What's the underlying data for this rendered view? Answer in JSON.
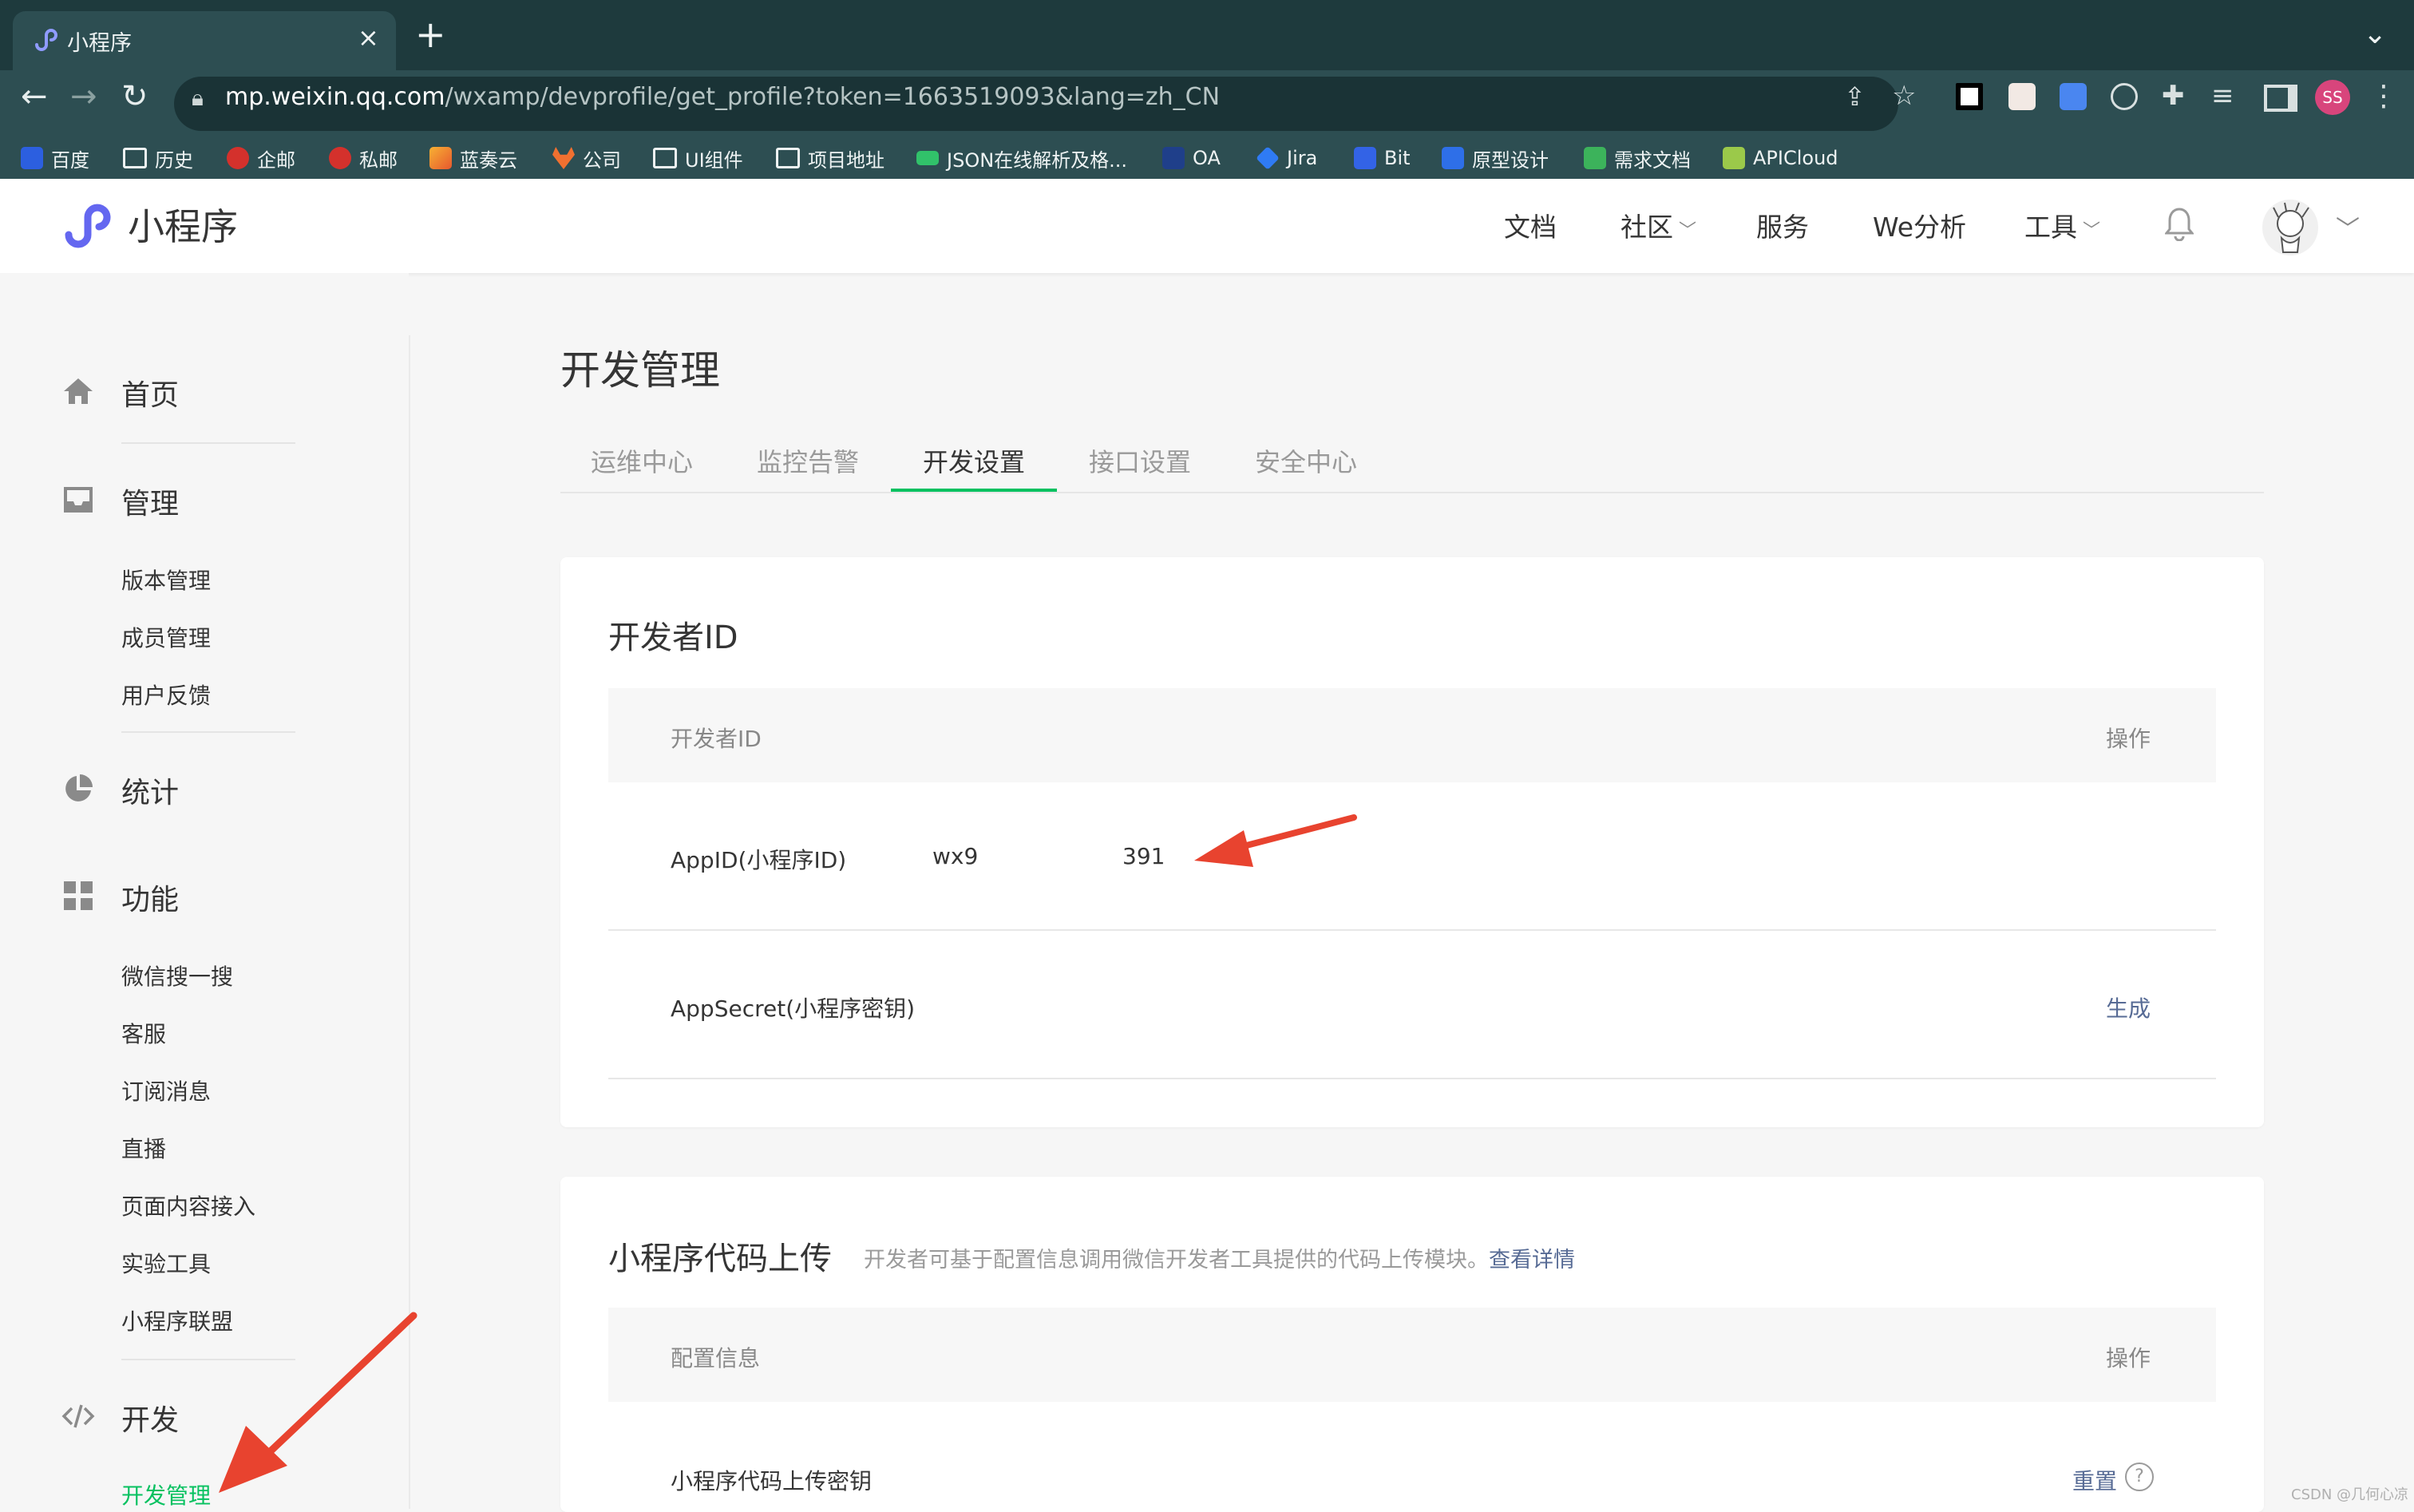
{
  "browser": {
    "tab_title": "小程序",
    "tab_close": "×",
    "new_tab": "+",
    "tab_menu": "⌄",
    "url_host": "mp.weixin.qq.com",
    "url_path": "/wxamp/devprofile/get_profile?token=1663519093&lang=zh_CN",
    "profile_initials": "SS",
    "bookmarks": [
      "百度",
      "历史",
      "企邮",
      "私邮",
      "蓝奏云",
      "公司",
      "UI组件",
      "项目地址",
      "JSON在线解析及格...",
      "OA",
      "Jira",
      "Bit",
      "原型设计",
      "需求文档",
      "APICloud"
    ]
  },
  "header": {
    "logo_text": "小程序",
    "nav": [
      "文档",
      "社区",
      "服务",
      "We分析",
      "工具"
    ]
  },
  "sidebar": {
    "home": "首页",
    "manage": "管理",
    "manage_items": [
      "版本管理",
      "成员管理",
      "用户反馈"
    ],
    "stats": "统计",
    "features": "功能",
    "feature_items": [
      "微信搜一搜",
      "客服",
      "订阅消息",
      "直播",
      "页面内容接入",
      "实验工具",
      "小程序联盟"
    ],
    "dev": "开发",
    "dev_items": [
      "开发管理"
    ]
  },
  "main": {
    "title": "开发管理",
    "tabs": [
      "运维中心",
      "监控告警",
      "开发设置",
      "接口设置",
      "安全中心"
    ],
    "active_tab": "开发设置",
    "dev_id_card": {
      "title": "开发者ID",
      "col_id": "开发者ID",
      "col_op": "操作",
      "appid_label": "AppID(小程序ID)",
      "appid_value_start": "wx9",
      "appid_value_end": "391",
      "appsecret_label": "AppSecret(小程序密钥)",
      "appsecret_action": "生成"
    },
    "upload_card": {
      "title": "小程序代码上传",
      "desc": "开发者可基于配置信息调用微信开发者工具提供的代码上传模块。",
      "desc_link": "查看详情",
      "col_config": "配置信息",
      "col_op": "操作",
      "row_key_label": "小程序代码上传密钥",
      "row_key_action": "重置",
      "help": "?"
    }
  },
  "watermark": "CSDN @几何心凉",
  "colors": {
    "accent_green": "#07c160",
    "link_blue": "#576b95",
    "arrow_red": "#e8432f",
    "logo_purple": "#6467f0"
  }
}
